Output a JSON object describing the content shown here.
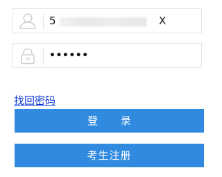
{
  "login_form": {
    "username": {
      "icon": "user-icon",
      "value_first": "5",
      "value_last": "X"
    },
    "password": {
      "icon": "lock-icon",
      "value": "••••••"
    },
    "forgot_password_label": "找回密码",
    "login_button_label": "登 录",
    "register_button_label": "考生注册"
  },
  "colors": {
    "primary_button": "#2f8ae0",
    "link": "#0b35d6",
    "field_border": "#e4e4e4"
  }
}
